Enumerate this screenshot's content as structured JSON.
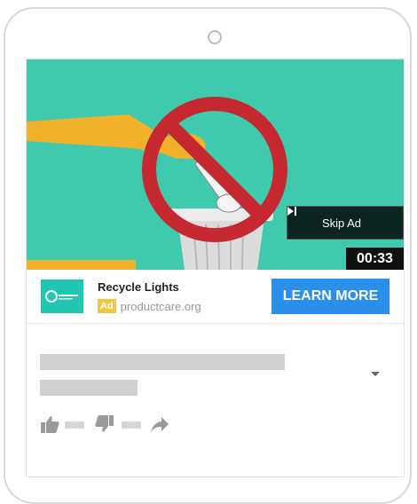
{
  "video": {
    "skip_label": "Skip Ad",
    "timer": "00:33"
  },
  "ad": {
    "title": "Recycle Lights",
    "badge": "Ad",
    "domain": "productcare.org",
    "cta": "LEARN MORE",
    "logo_color": "#1fc7b2",
    "cta_color": "#2a8fe8",
    "badge_color": "#f2c744"
  },
  "colors": {
    "video_background": "#3fc9ad",
    "prohibition_sign": "#c5282e",
    "arm": "#f2b12a",
    "placeholder": "#d0d0d0"
  },
  "icons": {
    "skip": "skip-next-icon",
    "expand": "chevron-down-icon",
    "like": "thumbs-up-icon",
    "dislike": "thumbs-down-icon",
    "share": "share-arrow-icon"
  }
}
